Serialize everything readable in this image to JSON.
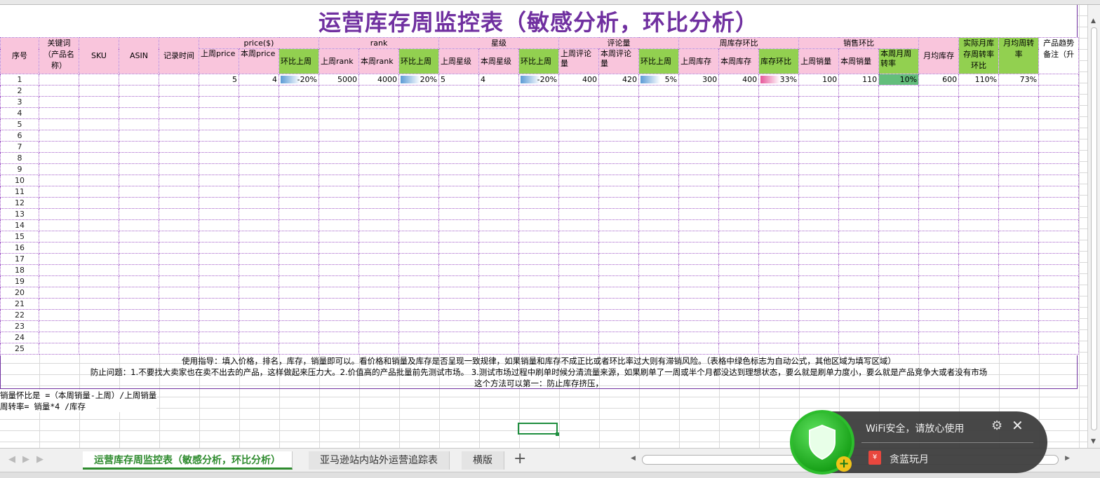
{
  "title": "运营库存周监控表（敏感分析，环比分析）",
  "groups": {
    "keyword": "关键词（产品名称）",
    "price": "price($)",
    "rank": "rank",
    "star": "星级",
    "review": "评论量",
    "stock": "周库存环比",
    "sales": "销售环比",
    "actual_turn": "实际月库存周转率环比",
    "avg_turn": "月均周转率",
    "trend": "产品趋势备注（升"
  },
  "headers": {
    "seq": "序号",
    "sku": "SKU",
    "asin": "ASIN",
    "record_time": "记录时间",
    "last_price": "上周price",
    "this_price": "本周price",
    "price_ratio": "环比上周",
    "last_rank": "上周rank",
    "this_rank": "本周rank",
    "rank_ratio": "环比上周",
    "last_star": "上周星级",
    "this_star": "本周星级",
    "star_ratio": "环比上周",
    "last_review": "上周评论量",
    "this_review": "本周评论量",
    "review_ratio": "环比上周",
    "last_stock": "上周库存",
    "this_stock": "本周库存",
    "stock_ratio": "库存环比",
    "last_sales": "上周销量",
    "this_sales": "本周销量",
    "month_turn": "本周月周转率",
    "month_stock": "月均库存"
  },
  "row1": {
    "seq": "1",
    "last_price": "5",
    "this_price": "4",
    "price_ratio": "-20%",
    "last_rank": "5000",
    "this_rank": "4000",
    "rank_ratio": "20%",
    "last_star": "5",
    "this_star": "4",
    "star_ratio": "-20%",
    "last_review": "400",
    "this_review": "420",
    "review_ratio": "5%",
    "last_stock": "300",
    "this_stock": "400",
    "stock_ratio": "33%",
    "last_sales": "100",
    "this_sales": "110",
    "month_turn": "10%",
    "month_stock": "600",
    "actual_turn": "110%",
    "avg_turn": "73%"
  },
  "row_numbers": [
    "2",
    "3",
    "4",
    "5",
    "6",
    "7",
    "8",
    "9",
    "10",
    "11",
    "12",
    "13",
    "14",
    "15",
    "16",
    "17",
    "18",
    "19",
    "20",
    "21",
    "22",
    "23",
    "24",
    "25"
  ],
  "notes": {
    "guide": "使用指导：填入价格，排名，库存，销量即可以。看价格和销量及库存是否呈现一致规律，如果销量和库存不成正比或者环比率过大则有滞销风险。（表格中绿色标志为自动公式，其他区域为填写区域）",
    "problems": "防止问题：1.不要找大卖家也在卖不出去的产品，这样做起来压力大。2.价值高的产品批量前先测试市场。   3.测试市场过程中刷单时候分清流量来源，如果刷单了一周或半个月都没达到理想状态，要么就是刷单力度小，要么就是产品竞争大或者没有市场",
    "method": "这个方法可以第一：防止库存挤压，"
  },
  "formulas": {
    "sales_ratio": "销量怀比是 =（本周销量-上周）/上周销量",
    "turnover": "周转率= 销量*4 /库存"
  },
  "tabs": [
    "运营库存周监控表（敏感分析，环比分析）",
    "亚马逊站内站外运营追踪表",
    "横版"
  ],
  "popup": {
    "title": "WiFi安全，请放心使用",
    "item": "贪蓝玩月"
  },
  "colors": {
    "title": "#7030a0",
    "header_pink": "#f9c5dc",
    "formula_green": "#92d050",
    "active_tab": "#2e8b2e"
  },
  "icons": [
    "shield-icon",
    "gear-icon",
    "close-icon",
    "plus-icon",
    "red-packet-icon"
  ]
}
